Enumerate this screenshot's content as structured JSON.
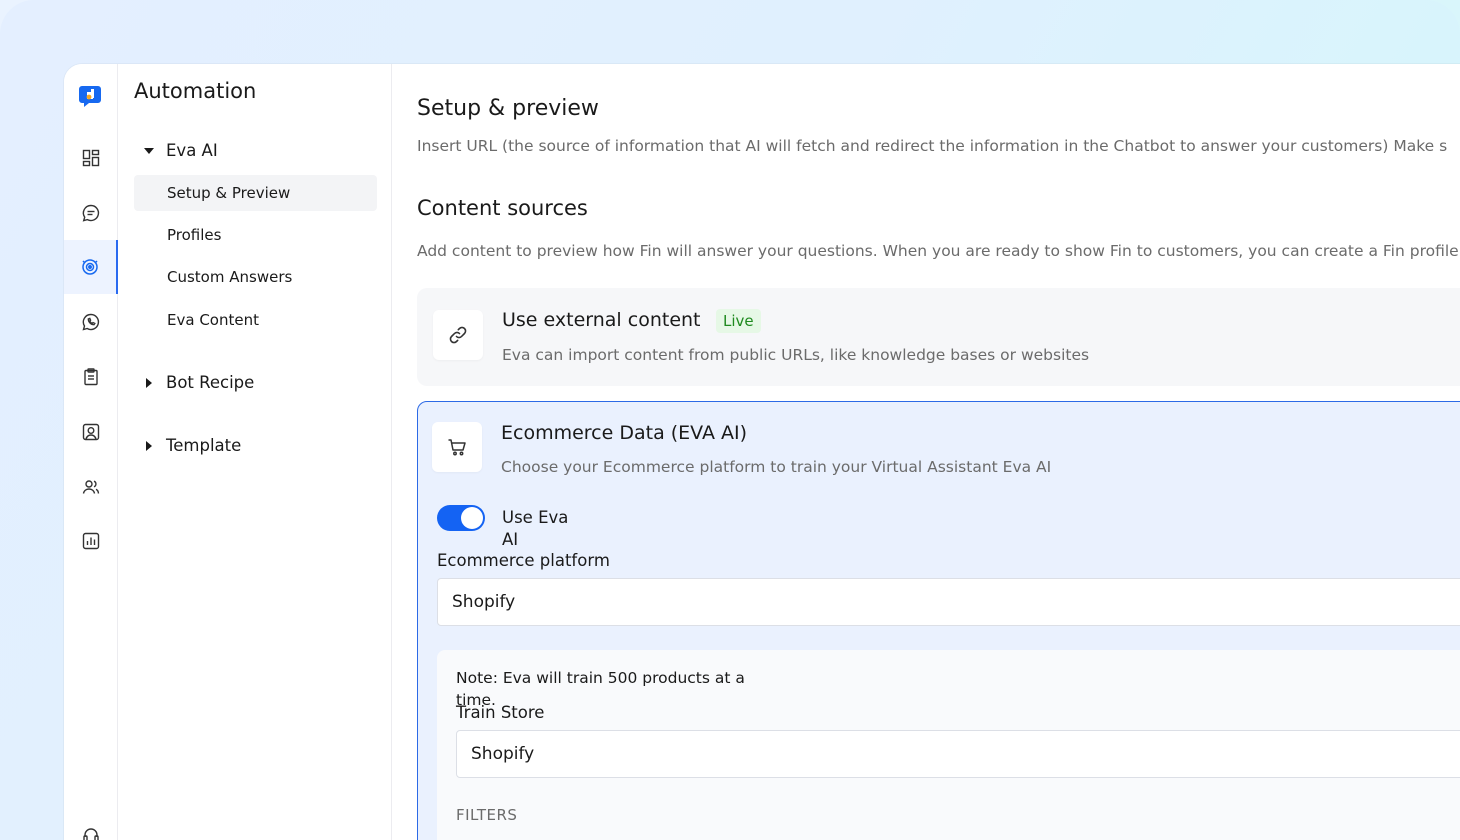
{
  "colors": {
    "accent": "#1463f3",
    "live_badge_bg": "#e6f8e6",
    "live_badge_text": "#1f8a1f",
    "selected_card_bg": "#eaf1fe"
  },
  "rail": {
    "logo_icon": "app-logo-icon",
    "items": [
      {
        "icon": "dashboard-icon"
      },
      {
        "icon": "chat-bubble-icon"
      },
      {
        "icon": "automation-icon",
        "active": true
      },
      {
        "icon": "whatsapp-icon"
      },
      {
        "icon": "clipboard-icon"
      },
      {
        "icon": "contact-card-icon"
      },
      {
        "icon": "users-icon"
      },
      {
        "icon": "bar-chart-icon"
      }
    ],
    "bottom_icon": "support-headset-icon"
  },
  "nav": {
    "title": "Automation",
    "groups": [
      {
        "label": "Eva AI",
        "expanded": true,
        "items": [
          {
            "label": "Setup & Preview",
            "active": true
          },
          {
            "label": "Profiles"
          },
          {
            "label": "Custom Answers"
          },
          {
            "label": "Eva Content"
          }
        ]
      },
      {
        "label": "Bot Recipe",
        "expanded": false
      },
      {
        "label": "Template",
        "expanded": false
      }
    ]
  },
  "main": {
    "setup_title": "Setup & preview",
    "setup_desc": "Insert URL (the source of information that AI will fetch and redirect the information in the Chatbot to answer your customers) Make s",
    "sources_title": "Content sources",
    "sources_desc": "Add content to preview how Fin will answer your questions. When you are ready to show Fin to customers, you can create a Fin profile",
    "external": {
      "title": "Use external content",
      "badge": "Live",
      "desc": "Eva can import content from public URLs, like knowledge bases or websites",
      "icon": "link-icon"
    },
    "ecommerce": {
      "title": "Ecommerce Data (EVA AI)",
      "desc": "Choose your Ecommerce platform to train your Virtual Assistant Eva AI",
      "icon": "cart-icon",
      "toggle_label": "Use Eva AI",
      "toggle_on": true,
      "platform_label": "Ecommerce platform",
      "platform_value": "Shopify",
      "note": "Note: Eva will train 500 products at a time.",
      "train_label": "Train Store",
      "train_value": "Shopify",
      "filters_label": "FILTERS"
    }
  }
}
